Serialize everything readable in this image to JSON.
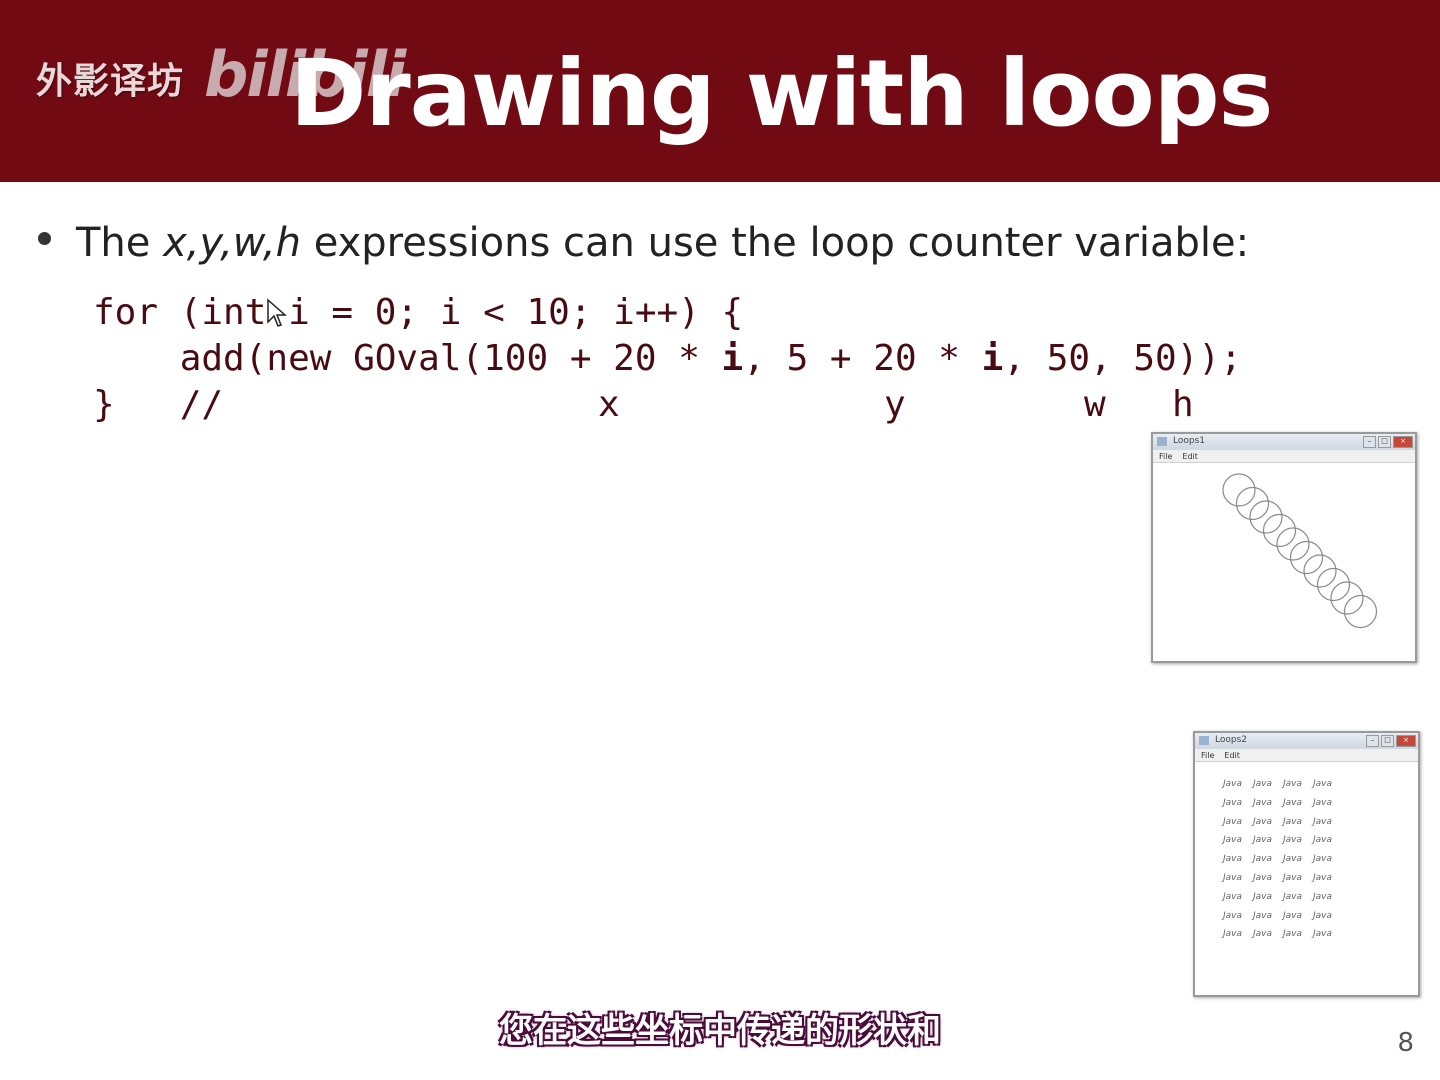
{
  "header": {
    "watermark_cn": "外影译坊",
    "watermark_bili": "bilibili",
    "title": "Drawing with loops"
  },
  "bullet": {
    "pre": "The ",
    "vars": "x,y,w,h",
    "post": " expressions can use the loop counter variable:"
  },
  "code": {
    "line1": "for (int i = 0; i < 10; i++) {",
    "line2_a": "    add(new GOval(100 + 20 * ",
    "line2_i1": "i",
    "line2_b": ", 5 + 20 * ",
    "line2_i2": "i",
    "line2_c": ", 50, 50));",
    "line3": "}   //",
    "comment_x": "x",
    "comment_y": "y",
    "comment_w": "w",
    "comment_h": "h"
  },
  "window1": {
    "title": "Loops1",
    "menu": [
      "File",
      "Edit"
    ],
    "circle_count": 10
  },
  "window2": {
    "title": "Loops2",
    "menu": [
      "File",
      "Edit"
    ],
    "cell_text": "Java",
    "rows": 9,
    "cols": 4
  },
  "subtitle": "您在这些坐标中传递的形状和",
  "page_number": "8",
  "colors": {
    "title_bar": "#720a14",
    "code_text": "#4a0a12"
  }
}
